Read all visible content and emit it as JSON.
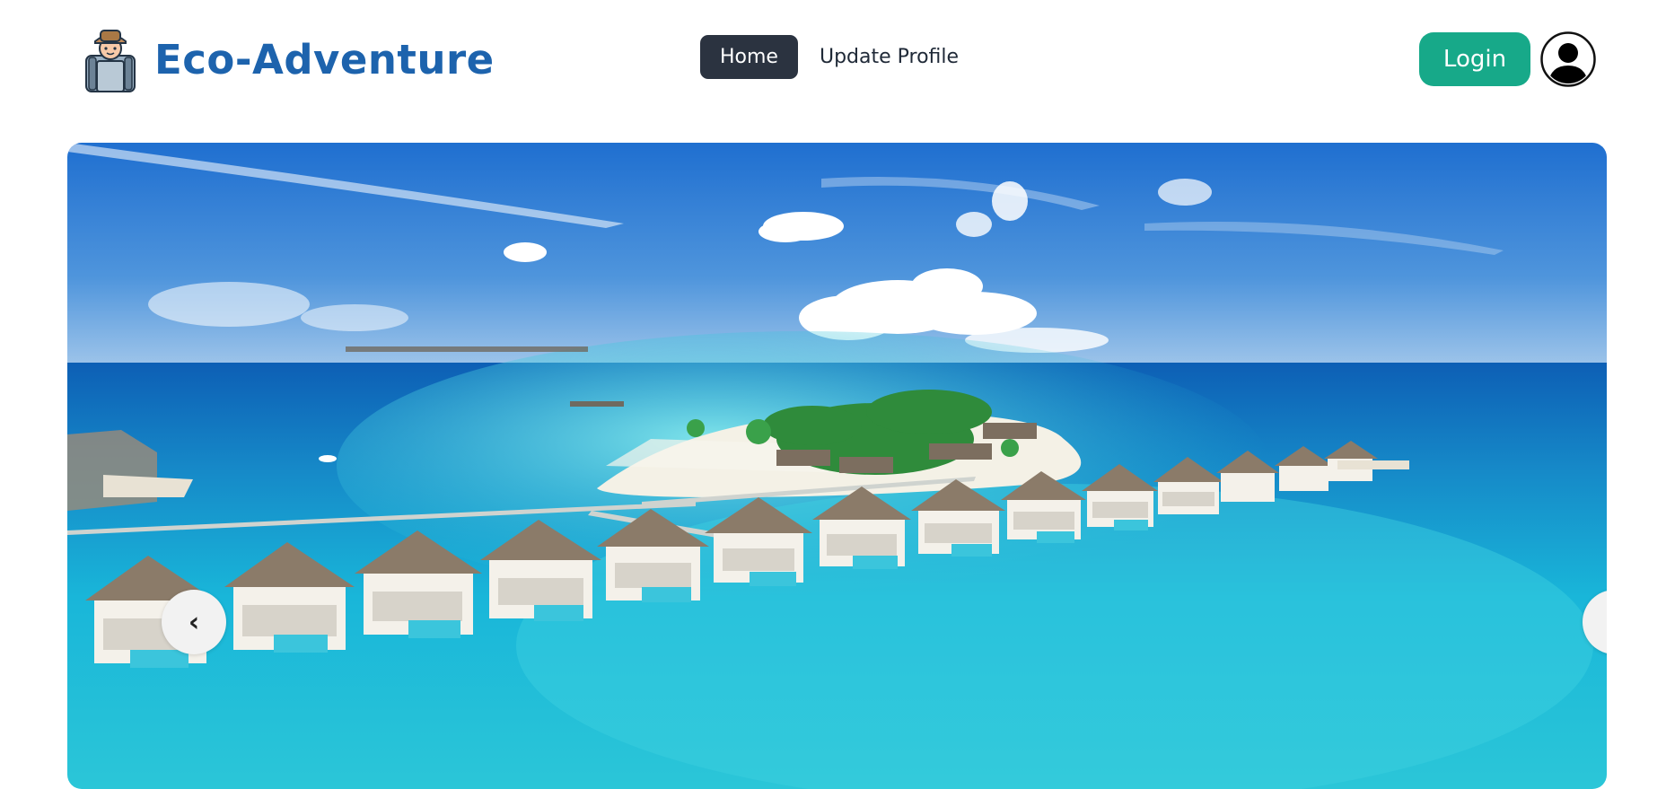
{
  "brand": {
    "title": "Eco-Adventure",
    "logo_icon": "hiker-icon",
    "color": "#1d63ad"
  },
  "nav": {
    "items": [
      {
        "label": "Home",
        "active": true
      },
      {
        "label": "Update Profile",
        "active": false
      }
    ]
  },
  "header": {
    "login_label": "Login",
    "login_color": "#17a989",
    "avatar_icon": "user-avatar-icon"
  },
  "carousel": {
    "slide_description_icon": "tropical-resort-image",
    "prev_label": "‹",
    "next_label": "›"
  }
}
